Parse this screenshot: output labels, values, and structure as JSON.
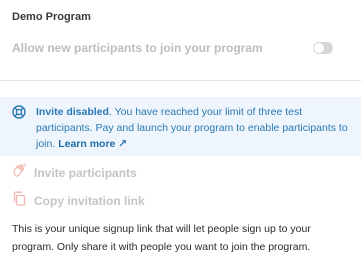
{
  "section": {
    "title": "Demo Program"
  },
  "toggle": {
    "label": "Allow new participants to join your program",
    "enabled": false
  },
  "notice": {
    "title": "Invite disabled",
    "message": ". You have reached your limit of three test participants. Pay and launch your program to enable participants to join. ",
    "link": "Learn more",
    "link_arrow": "↗",
    "icon": "lifebuoy-icon",
    "color": "#2b79b3",
    "background": "#eef5fc"
  },
  "actions": {
    "invite": {
      "label": "Invite participants",
      "icon": "hand-wave-icon"
    },
    "copy": {
      "label": "Copy invitation link",
      "icon": "copy-icon"
    },
    "icon_color": "#f2b8b0"
  },
  "description": "This is your unique signup link that will let people sign up to your program. Only share it with people you want to join the program."
}
